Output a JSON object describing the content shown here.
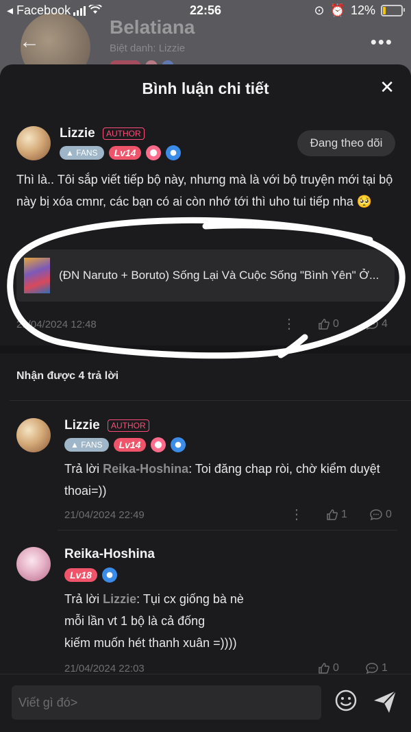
{
  "status": {
    "back_app": "◂ Facebook",
    "time": "22:56",
    "battery": "12%",
    "battery_level": 0.12
  },
  "profile_bg": {
    "name": "Belatiana",
    "nickname": "Biệt danh: Lizzie",
    "alt_name": "Lizzie"
  },
  "sheet": {
    "title": "Bình luận chi tiết"
  },
  "comment": {
    "user": "Lizzie",
    "author_tag": "AUTHOR",
    "fans_label": "FANS",
    "level": "Lv14",
    "follow_label": "Đang theo dõi",
    "text": "Thì là.. Tôi sắp viết tiếp bộ này, nhưng mà là với bộ truyện mới tại bộ này bị xóa cmnr, các bạn có ai còn nhớ tới thì uho tui tiếp nha 🥺",
    "book_title": "(ĐN Naruto + Boruto) Sống Lại Và Cuộc Sống \"Bình Yên\" Ở...",
    "timestamp": "21/04/2024 12:48",
    "likes": "0",
    "replies": "4"
  },
  "replies_header": "Nhận được 4 trả lời",
  "replies": [
    {
      "user": "Lizzie",
      "author_tag": "AUTHOR",
      "fans_label": "FANS",
      "level": "Lv14",
      "prefix": "Trả lời ",
      "mention": "Reika-Hoshina",
      "text": ": Toi đăng chap ròi, chờ kiểm duyệt thoai=))",
      "timestamp": "21/04/2024 22:49",
      "likes": "1",
      "replies": "0"
    },
    {
      "user": "Reika-Hoshina",
      "level": "Lv18",
      "prefix": "Trả lời ",
      "mention": "Lizzie",
      "line1": ": Tụi cx giống bà nè",
      "line2": "mỗi lần vt 1 bộ là cả đống",
      "line3": "kiếm muốn hét thanh xuân =))))",
      "timestamp": "21/04/2024 22:03",
      "likes": "0",
      "replies": "1"
    }
  ],
  "input": {
    "placeholder": "Viết gì đó>"
  },
  "colors": {
    "accent_pink": "#ff4d79",
    "level_red": "#f0546a",
    "fans_blue": "#9eb6c7",
    "background": "#1b1b1d"
  },
  "icons": [
    "back-arrow-icon",
    "more-icon",
    "close-icon",
    "like-icon",
    "reply-icon",
    "emoji-icon",
    "send-icon"
  ]
}
